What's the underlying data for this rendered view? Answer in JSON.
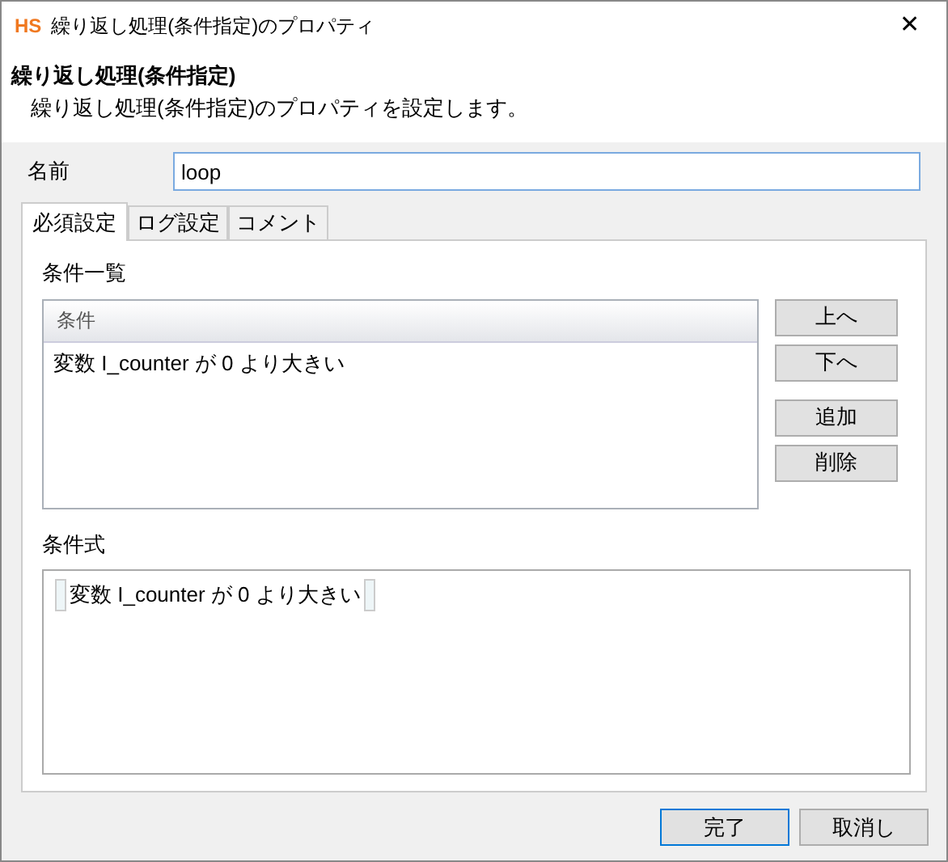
{
  "window": {
    "logo": "HS",
    "title": "繰り返し処理(条件指定)のプロパティ",
    "close": "✕"
  },
  "header": {
    "title": "繰り返し処理(条件指定)",
    "description": "繰り返し処理(条件指定)のプロパティを設定します。"
  },
  "name_field": {
    "label": "名前",
    "value": "loop"
  },
  "tabs": [
    {
      "label": "必須設定",
      "selected": true
    },
    {
      "label": "ログ設定",
      "selected": false
    },
    {
      "label": "コメント",
      "selected": false
    }
  ],
  "condition_list": {
    "label": "条件一覧",
    "column": "条件",
    "rows": [
      {
        "text": "変数 I_counter が 0 より大きい",
        "selected": false
      }
    ]
  },
  "side_buttons": [
    "上へ",
    "下へ",
    "追加",
    "削除"
  ],
  "expression": {
    "label": "条件式",
    "tokens": [
      "変数 I_counter が 0 より大きい"
    ]
  },
  "buttons": [
    {
      "label": "完了",
      "default": true
    },
    {
      "label": "取消し",
      "default": false
    }
  ]
}
